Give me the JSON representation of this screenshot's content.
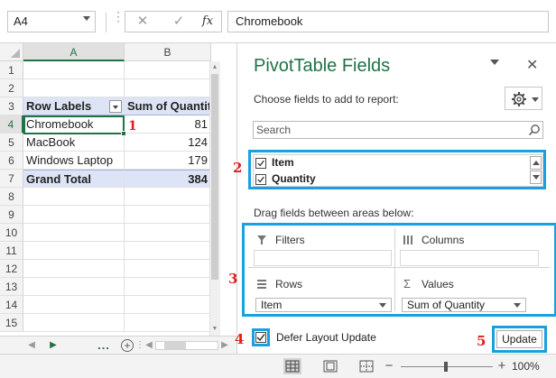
{
  "formula_bar": {
    "name_box": "A4",
    "cancel_icon": "✕",
    "enter_icon": "✓",
    "fx_label": "fx",
    "value": "Chromebook"
  },
  "grid": {
    "columns": [
      "A",
      "B"
    ],
    "rows": [
      "1",
      "2",
      "3",
      "4",
      "5",
      "6",
      "7",
      "8",
      "9",
      "10",
      "11",
      "12",
      "13",
      "14",
      "15"
    ],
    "selected_column": "A",
    "selected_row": "4",
    "pivot": {
      "header_row_labels": "Row Labels",
      "header_sum": "Sum of Quantity",
      "items": [
        {
          "label": "Chromebook",
          "value": "81"
        },
        {
          "label": "MacBook",
          "value": "124"
        },
        {
          "label": "Windows Laptop",
          "value": "179"
        }
      ],
      "total_label": "Grand Total",
      "total_value": "384"
    }
  },
  "markers": {
    "m1": "1",
    "m2": "2",
    "m3": "3",
    "m4": "4",
    "m5": "5"
  },
  "tabbar": {
    "prev": "◀",
    "next": "▶",
    "dots": "...",
    "add": "+"
  },
  "statusbar": {
    "zoom_minus": "−",
    "zoom_plus": "+",
    "zoom": "100%",
    "zoom_level_percent": 100
  },
  "pane": {
    "title": "PivotTable Fields",
    "close": "✕",
    "choose_label": "Choose fields to add to report:",
    "search_placeholder": "Search",
    "fields": [
      {
        "label": "Item",
        "checked": true
      },
      {
        "label": "Quantity",
        "checked": true
      }
    ],
    "drag_label": "Drag fields between areas below:",
    "areas": {
      "filters": "Filters",
      "columns": "Columns",
      "rows": "Rows",
      "values": "Values",
      "rows_item": "Item",
      "values_item": "Sum of Quantity"
    },
    "defer_label": "Defer Layout Update",
    "defer_checked": true,
    "update_label": "Update"
  },
  "colors": {
    "excel_green": "#217346",
    "pivot_header_bg": "#dde4f5",
    "annotation_blue": "#1aa0dc",
    "annotation_red": "#e21c1c"
  }
}
